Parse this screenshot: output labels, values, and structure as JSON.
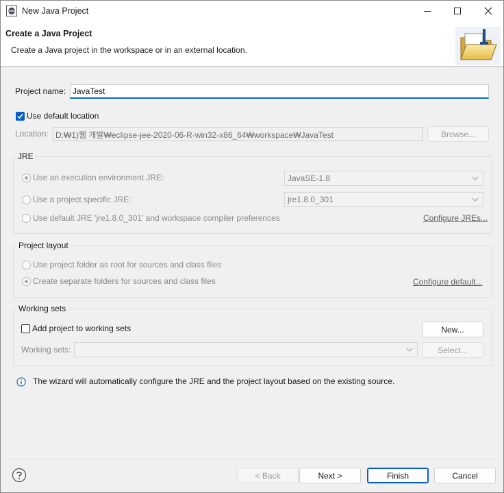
{
  "window": {
    "title": "New Java Project"
  },
  "banner": {
    "title": "Create a Java Project",
    "description": "Create a Java project in the workspace or in an external location."
  },
  "project_name": {
    "label": "Project name:",
    "value": "JavaTest"
  },
  "location": {
    "use_default_label": "Use default location",
    "use_default_checked": true,
    "label": "Location:",
    "value": "D:₩1)웹 개발₩eclipse-jee-2020-06-R-win32-x86_64₩workspace₩JavaTest",
    "browse_label": "Browse..."
  },
  "jre": {
    "group_label": "JRE",
    "option_env_label": "Use an execution environment JRE:",
    "option_env_value": "JavaSE-1.8",
    "option_specific_label": "Use a project specific JRE:",
    "option_specific_value": "jre1.8.0_301",
    "option_default_label": "Use default JRE 'jre1.8.0_301' and workspace compiler preferences",
    "configure_link": "Configure JREs..."
  },
  "layout": {
    "group_label": "Project layout",
    "option_root_label": "Use project folder as root for sources and class files",
    "option_separate_label": "Create separate folders for sources and class files",
    "configure_link": "Configure default..."
  },
  "working_sets": {
    "group_label": "Working sets",
    "add_label": "Add project to working sets",
    "new_button": "New...",
    "sets_label": "Working sets:",
    "select_button": "Select..."
  },
  "info": {
    "text": "The wizard will automatically configure the JRE and the project layout based on the existing source."
  },
  "footer": {
    "back": "< Back",
    "next": "Next >",
    "finish": "Finish",
    "cancel": "Cancel"
  },
  "colors": {
    "accent": "#0a5fc7",
    "focus_underline": "#0a66c2"
  }
}
